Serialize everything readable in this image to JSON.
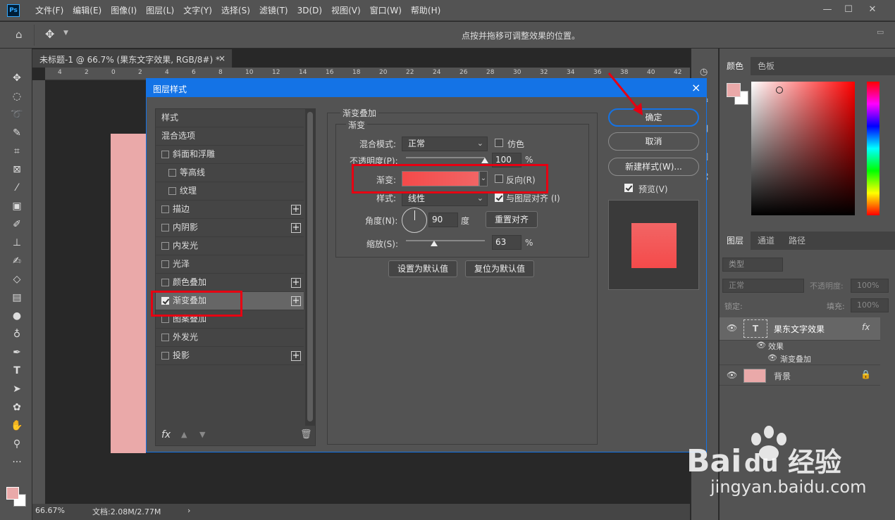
{
  "menubar": {
    "logo": "Ps",
    "items": [
      "文件(F)",
      "编辑(E)",
      "图像(I)",
      "图层(L)",
      "文字(Y)",
      "选择(S)",
      "滤镜(T)",
      "3D(D)",
      "视图(V)",
      "窗口(W)",
      "帮助(H)"
    ]
  },
  "optbar": {
    "hint": "点按并拖移可调整效果的位置。"
  },
  "doc": {
    "tab": "未标题-1 @ 66.7% (果东文字效果, RGB/8#) *",
    "tab_close": "×",
    "ruler_ticks": [
      "4",
      "2",
      "0",
      "2",
      "4",
      "6",
      "8",
      "10",
      "12",
      "14",
      "16",
      "18",
      "20",
      "22",
      "24",
      "26",
      "28",
      "30",
      "32",
      "34",
      "36",
      "38",
      "40",
      "42"
    ],
    "zoom": "66.67%",
    "docsize": "文档:2.08M/2.77M",
    "status_arrow": "›"
  },
  "dialog": {
    "title": "图层样式",
    "close": "×",
    "styles_list": [
      {
        "label": "样式",
        "checkbox": false,
        "checked": false,
        "plus": false,
        "indent": 0
      },
      {
        "label": "混合选项",
        "checkbox": false,
        "checked": false,
        "plus": false,
        "indent": 0
      },
      {
        "label": "斜面和浮雕",
        "checkbox": true,
        "checked": false,
        "plus": false,
        "indent": 0
      },
      {
        "label": "等高线",
        "checkbox": true,
        "checked": false,
        "plus": false,
        "indent": 1
      },
      {
        "label": "纹理",
        "checkbox": true,
        "checked": false,
        "plus": false,
        "indent": 1
      },
      {
        "label": "描边",
        "checkbox": true,
        "checked": false,
        "plus": true,
        "indent": 0
      },
      {
        "label": "内阴影",
        "checkbox": true,
        "checked": false,
        "plus": true,
        "indent": 0
      },
      {
        "label": "内发光",
        "checkbox": true,
        "checked": false,
        "plus": false,
        "indent": 0
      },
      {
        "label": "光泽",
        "checkbox": true,
        "checked": false,
        "plus": false,
        "indent": 0
      },
      {
        "label": "颜色叠加",
        "checkbox": true,
        "checked": false,
        "plus": true,
        "indent": 0
      },
      {
        "label": "渐变叠加",
        "checkbox": true,
        "checked": true,
        "plus": true,
        "indent": 0,
        "selected": true
      },
      {
        "label": "图案叠加",
        "checkbox": true,
        "checked": false,
        "plus": false,
        "indent": 0
      },
      {
        "label": "外发光",
        "checkbox": true,
        "checked": false,
        "plus": false,
        "indent": 0
      },
      {
        "label": "投影",
        "checkbox": true,
        "checked": false,
        "plus": true,
        "indent": 0
      }
    ],
    "fx_label": "fx",
    "section_title": "渐变叠加",
    "subsection_title": "渐变",
    "blend_mode_label": "混合模式:",
    "blend_mode_value": "正常",
    "dither_label": "仿色",
    "opacity_label": "不透明度(P):",
    "opacity_value": "100",
    "opacity_unit": "%",
    "opacity_level": 1.0,
    "gradient_label": "渐变:",
    "reverse_label": "反向(R)",
    "style_label": "样式:",
    "style_value": "线性",
    "align_label": "与图层对齐 (I)",
    "angle_label": "角度(N):",
    "angle_value": "90",
    "angle_unit": "度",
    "reset_align": "重置对齐",
    "scale_label": "缩放(S):",
    "scale_value": "63",
    "scale_unit": "%",
    "scale_level": 0.63,
    "set_default": "设置为默认值",
    "reset_default": "复位为默认值",
    "ok": "确定",
    "cancel": "取消",
    "new_style": "新建样式(W)...",
    "preview_label": "预览(V)",
    "colors": {
      "gradient_from": "#f44a4a",
      "gradient_to": "#f26565",
      "highlight": "#e60012"
    }
  },
  "panels": {
    "color_tabs": [
      "颜色",
      "色板"
    ],
    "layers_tabs": [
      "图层",
      "通道",
      "路径"
    ],
    "filter_kind": "类型",
    "blend_mode": "正常",
    "opacity_label": "不透明度:",
    "opacity_value": "100%",
    "lock_label": "锁定:",
    "fill_label": "填充:",
    "fill_value": "100%",
    "layers": {
      "text_layer": "果东文字效果",
      "effects": "效果",
      "gradient_effect": "渐变叠加",
      "background": "背景",
      "fx": "fx"
    },
    "fg_color": "#eaa9a9",
    "bg_color": "#ffffff"
  },
  "watermark": {
    "brand_main": "Bai",
    "brand_du": "du",
    "brand_cn": "经验",
    "url": "jingyan.baidu.com"
  }
}
